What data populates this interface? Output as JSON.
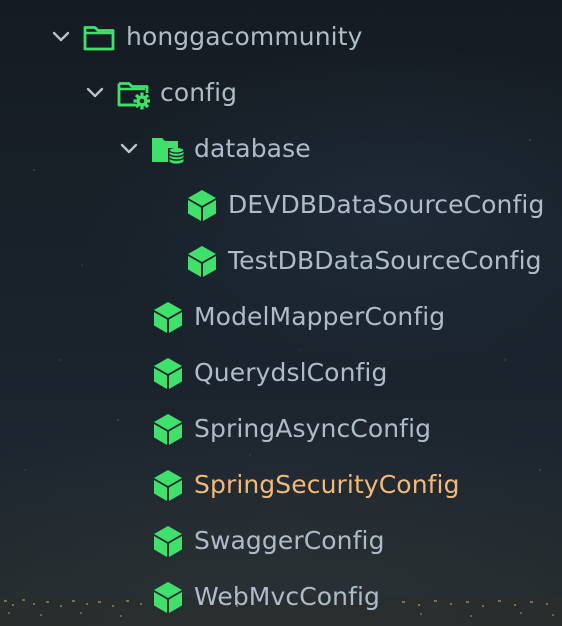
{
  "project_tree": {
    "root": {
      "label": "honggacommunity",
      "icon": "folder-icon",
      "expanded": true
    },
    "config": {
      "label": "config",
      "icon": "config-folder-icon",
      "expanded": true
    },
    "database": {
      "label": "database",
      "icon": "database-folder-icon",
      "expanded": true
    },
    "database_classes": [
      {
        "label": "DEVDBDataSourceConfig",
        "icon": "class-cube-icon"
      },
      {
        "label": "TestDBDataSourceConfig",
        "icon": "class-cube-icon"
      }
    ],
    "config_classes": [
      {
        "label": "ModelMapperConfig",
        "icon": "class-cube-icon"
      },
      {
        "label": "QuerydslConfig",
        "icon": "class-cube-icon"
      },
      {
        "label": "SpringAsyncConfig",
        "icon": "class-cube-icon"
      },
      {
        "label": "SpringSecurityConfig",
        "icon": "class-cube-icon",
        "status": "modified"
      },
      {
        "label": "SwaggerConfig",
        "icon": "class-cube-icon"
      },
      {
        "label": "WebMvcConfig",
        "icon": "class-cube-icon"
      }
    ]
  },
  "colors": {
    "label_default": "#aebcc9",
    "label_modified": "#f3b978",
    "icon_green": "#3fe16a",
    "chevron": "#b8c2cc"
  }
}
